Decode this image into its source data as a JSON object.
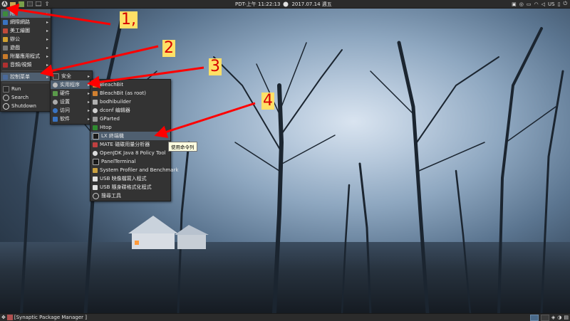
{
  "topbar": {
    "clock": "PDT-上午 11:22:13",
    "date": "2017.07.14 週五",
    "tray_lang": "US"
  },
  "main_menu": [
    {
      "label": "附",
      "icon": "internet-icon",
      "arrow": "▸"
    },
    {
      "label": "網際網路",
      "icon": "network-icon",
      "arrow": "▸"
    },
    {
      "label": "美工繪圖",
      "icon": "graphics-icon",
      "arrow": "▸"
    },
    {
      "label": "辦公",
      "icon": "office-icon",
      "arrow": "▸"
    },
    {
      "label": "遊戲",
      "icon": "games-icon",
      "arrow": "▸"
    },
    {
      "label": "附屬應用程式",
      "icon": "accessories-icon",
      "arrow": "▸"
    },
    {
      "label": "音頻/視頻",
      "icon": "media-icon",
      "arrow": "▸"
    },
    {
      "label": "控制菜单",
      "icon": "control-icon",
      "arrow": "▸"
    },
    {
      "label": "Run",
      "icon": "run-icon",
      "arrow": ""
    },
    {
      "label": "Search",
      "icon": "search-icon",
      "arrow": ""
    },
    {
      "label": "Shutdown",
      "icon": "shutdown-icon",
      "arrow": ""
    }
  ],
  "control_menu": [
    {
      "label": "安全",
      "arrow": "▸"
    },
    {
      "label": "实用程序",
      "arrow": "▸"
    },
    {
      "label": "硬件",
      "arrow": "▸"
    },
    {
      "label": "设置",
      "arrow": "▸"
    },
    {
      "label": "访问",
      "arrow": "▸"
    },
    {
      "label": "软件",
      "arrow": "▸"
    }
  ],
  "utilities_menu": [
    {
      "label": "BleachBit"
    },
    {
      "label": "BleachBit (as root)"
    },
    {
      "label": "bodhibuilder"
    },
    {
      "label": "dconf 编辑器"
    },
    {
      "label": "GParted"
    },
    {
      "label": "Htop"
    },
    {
      "label": "LX 終端機"
    },
    {
      "label": "MATE 磁碟用量分析器"
    },
    {
      "label": "OpenJDK Java 8 Policy Tool"
    },
    {
      "label": "PanelTerminal"
    },
    {
      "label": "System Profiler and Benchmark"
    },
    {
      "label": "USB 映像檔寫入程式"
    },
    {
      "label": "USB 隨身碟格式化程式"
    },
    {
      "label": "搜尋工具"
    }
  ],
  "tooltip": "使用命令列",
  "taskbar": {
    "task_label": "[Synaptic Package Manager ]"
  },
  "annotations": {
    "n1": "1,",
    "n2": "2",
    "n3": "3",
    "n4": "4"
  },
  "colors": {
    "arrow": "#ff0000",
    "highlight": "#4f5f70",
    "label_bg": "#ffe066"
  }
}
